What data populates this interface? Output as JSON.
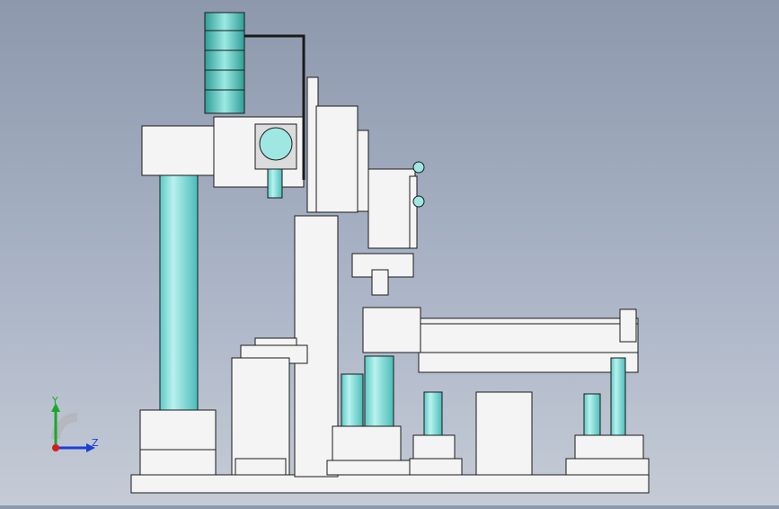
{
  "viewport": {
    "background_top": "#8d98ad",
    "background_bottom": "#c5cbd6",
    "part_fill": "#f2f2f2",
    "part_stroke": "#1a1a1a",
    "cylinder_fill": "#8fe3e0",
    "cylinder_dark": "#3fb7b3"
  },
  "triad": {
    "y_label": "Y",
    "z_label": "Z",
    "y_color": "#19a82a",
    "z_color": "#1b3fd6",
    "x_color": "#d61b1b"
  }
}
